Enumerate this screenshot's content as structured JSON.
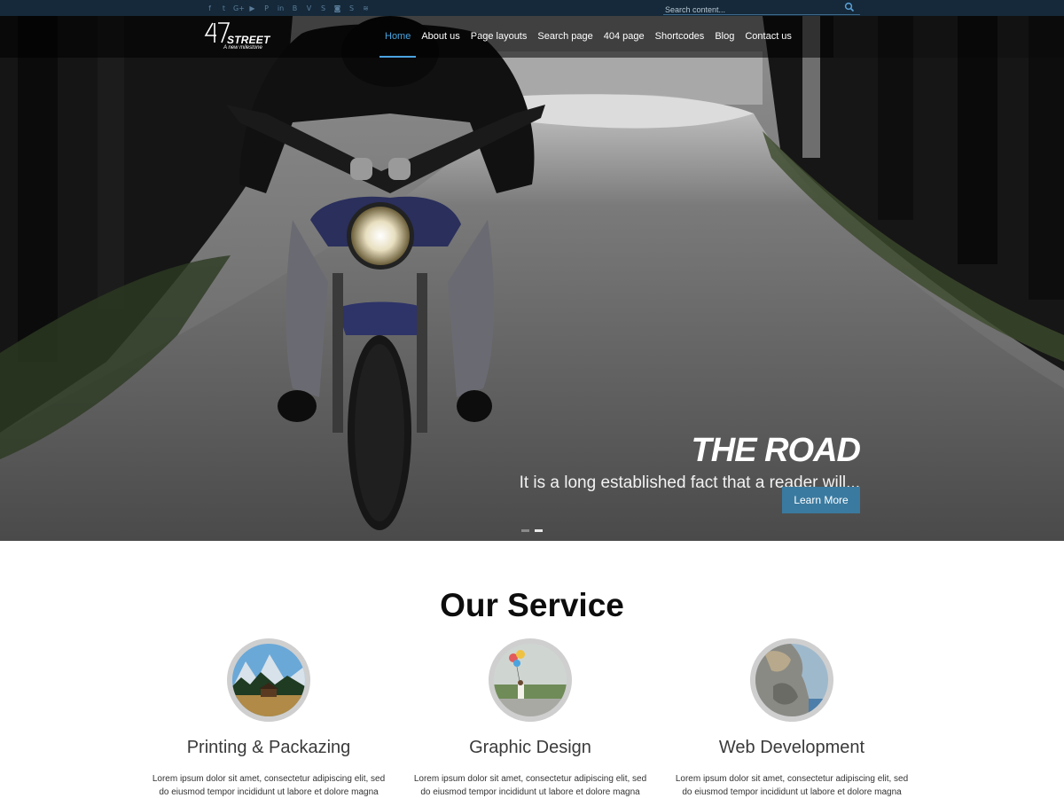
{
  "topbar": {
    "social_icons": [
      "facebook-icon",
      "twitter-icon",
      "google-plus-icon",
      "youtube-icon",
      "pinterest-icon",
      "linkedin-icon",
      "behance-icon",
      "vimeo-icon",
      "stumbleupon-icon",
      "instagram-icon",
      "skype-icon",
      "rss-icon"
    ],
    "search": {
      "placeholder": "Search content..."
    }
  },
  "logo": {
    "brand": "STREET",
    "tagline": "A new milestone",
    "numeral": "47"
  },
  "nav": {
    "items": [
      {
        "label": "Home",
        "active": true
      },
      {
        "label": "About us"
      },
      {
        "label": "Page layouts"
      },
      {
        "label": "Search page"
      },
      {
        "label": "404 page"
      },
      {
        "label": "Shortcodes"
      },
      {
        "label": "Blog"
      },
      {
        "label": "Contact us"
      }
    ]
  },
  "hero": {
    "title": "THE ROAD",
    "subtitle": "It is a long established fact that a reader will...",
    "button": "Learn More",
    "slides": 2,
    "active_slide": 2
  },
  "services": {
    "title": "Our Service",
    "items": [
      {
        "title": "Printing & Packazing",
        "text": "Lorem ipsum dolor sit amet, consectetur adipiscing elit, sed do eiusmod tempor incididunt ut labore et dolore magna aliqua."
      },
      {
        "title": "Graphic Design",
        "text": "Lorem ipsum dolor sit amet, consectetur adipiscing elit, sed do eiusmod tempor incididunt ut labore et dolore magna aliqua."
      },
      {
        "title": "Web Development",
        "text": "Lorem ipsum dolor sit amet, consectetur adipiscing elit, sed do eiusmod tempor incididunt ut labore et dolore magna aliqua."
      }
    ]
  },
  "colors": {
    "accent": "#4aa3df",
    "topbar": "#15293a",
    "button": "#3a7aa0"
  }
}
